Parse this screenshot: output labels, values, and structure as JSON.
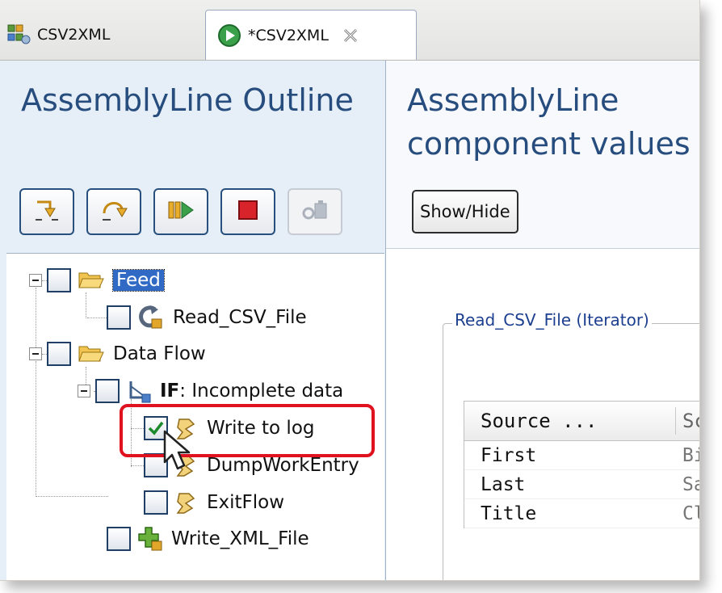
{
  "tabs": [
    {
      "label": "CSV2XML",
      "icon": "assembly-line-icon"
    },
    {
      "label": "*CSV2XML",
      "icon": "run-icon",
      "close_icon": "close-icon"
    }
  ],
  "outline": {
    "title": "AssemblyLine Outline",
    "toolbar": [
      "step-into-icon",
      "step-over-icon",
      "run-to-icon",
      "stop-icon",
      "debug-tool-icon"
    ],
    "tree": {
      "feed": {
        "label": "Feed"
      },
      "read_csv": {
        "label": "Read_CSV_File"
      },
      "data_flow": {
        "label": "Data Flow"
      },
      "if_prefix": "IF",
      "if_rest": ": Incomplete data",
      "write_log": {
        "label": "Write to log"
      },
      "dump": {
        "label": "DumpWorkEntry"
      },
      "exit": {
        "label": "ExitFlow"
      },
      "write_xml": {
        "label": "Write_XML_File"
      }
    }
  },
  "values": {
    "title": "AssemblyLine component values",
    "show_hide": "Show/Hide",
    "group_label": "Read_CSV_File (Iterator)",
    "table": {
      "headers": [
        "Source ...",
        "Sc"
      ],
      "rows": [
        [
          "First",
          "Bi"
        ],
        [
          "Last",
          "Sa"
        ],
        [
          "Title",
          "Cl"
        ]
      ]
    }
  },
  "colors": {
    "title": "#274d7e",
    "highlight": "#e0121f",
    "selection": "#316ac5"
  }
}
